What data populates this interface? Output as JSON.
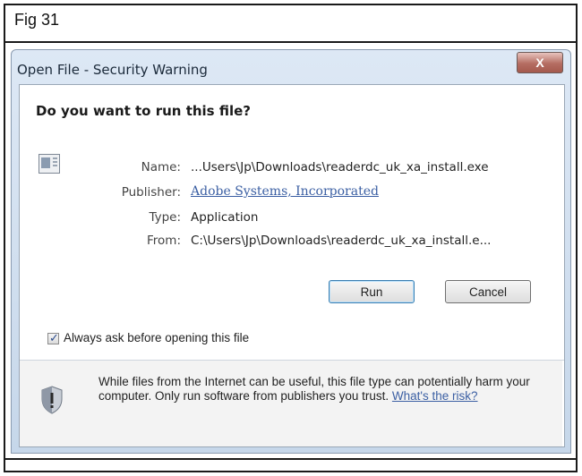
{
  "figure": {
    "caption": "Fig 31"
  },
  "window": {
    "title": "Open File - Security Warning",
    "close_label": "X"
  },
  "dialog": {
    "question": "Do you want to run this file?",
    "fields": [
      {
        "label": "Name:",
        "value": "...Users\\Jp\\Downloads\\readerdc_uk_xa_install.exe"
      },
      {
        "label": "Publisher:",
        "value": "Adobe Systems, Incorporated"
      },
      {
        "label": "Type:",
        "value": "Application"
      },
      {
        "label": "From:",
        "value": "C:\\Users\\Jp\\Downloads\\readerdc_uk_xa_install.e..."
      }
    ],
    "run_label": "Run",
    "cancel_label": "Cancel",
    "checkbox": {
      "label": "Always ask before opening this file",
      "checked": true
    },
    "warning_text": "While files from the Internet can be useful, this file type can potentially harm your computer. Only run software from publishers you trust.",
    "warning_link": "What's the risk?"
  },
  "icons": {
    "file": "file-icon",
    "shield": "shield-icon",
    "close": "close-icon"
  }
}
